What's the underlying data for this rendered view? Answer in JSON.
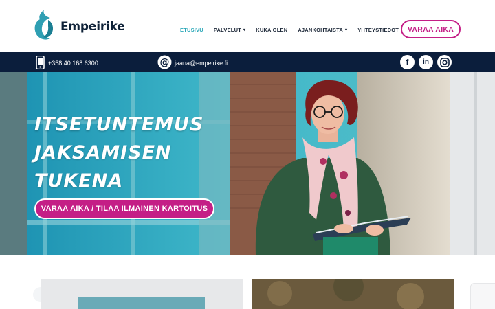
{
  "brand": {
    "name": "Empeirike"
  },
  "nav": {
    "items": [
      {
        "label": "ETUSIVU",
        "active": true
      },
      {
        "label": "PALVELUT",
        "dropdown": true
      },
      {
        "label": "KUKA OLEN"
      },
      {
        "label": "AJANKOHTAISTA",
        "dropdown": true
      },
      {
        "label": "YHTEYSTIEDOT"
      }
    ]
  },
  "header_cta": {
    "label": "VARAA AIKA"
  },
  "contact": {
    "phone": "+358 40 168 6300",
    "email": "jaana@empeirike.fi"
  },
  "socials": [
    {
      "icon": "facebook-icon",
      "glyph": "f"
    },
    {
      "icon": "linkedin-icon",
      "glyph": "in"
    },
    {
      "icon": "instagram-icon",
      "glyph": "◎"
    }
  ],
  "hero": {
    "title_lines": [
      "ITSETUNTEMUS",
      "JAKSAMISEN",
      "TUKENA"
    ],
    "cta_label": "VARAA AIKA / TILAA ILMAINEN KARTOITUS"
  },
  "colors": {
    "accent": "#c41e86",
    "active_nav": "#2aa7b8",
    "infobar": "#0b1e3c",
    "logo_teal": "#2f9fb3"
  }
}
